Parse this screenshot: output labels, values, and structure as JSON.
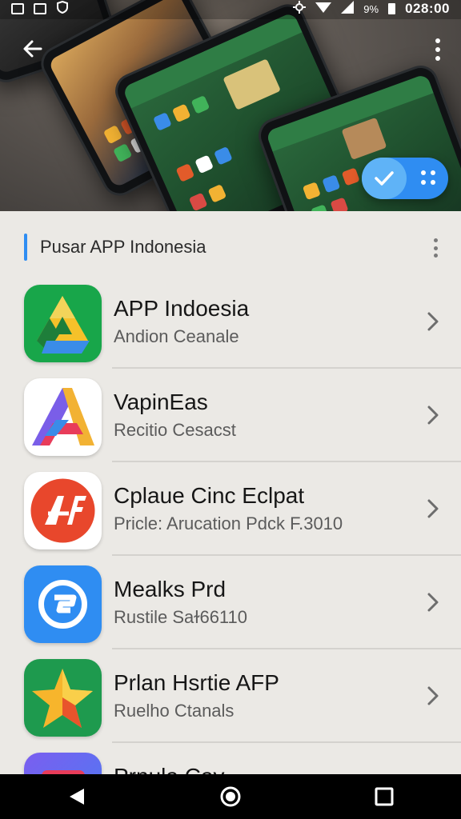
{
  "status_bar": {
    "battery": "9%",
    "time": "028:00"
  },
  "header": {
    "back_icon": "arrow-left-icon",
    "more_icon": "more-vertical-icon"
  },
  "fab": {
    "check_icon": "check-icon",
    "grid_icon": "grid-icon",
    "color_primary": "#2f8df2",
    "color_light": "#5fb3f7"
  },
  "section": {
    "title": "Pusar APP Indonesia",
    "accent_color": "#2f8df2"
  },
  "apps": [
    {
      "title": "APP Indoesia",
      "subtitle": "Andion Ceanale",
      "icon": "drive-like-icon"
    },
    {
      "title": "VapinEas",
      "subtitle": "Recitio Cesacst",
      "icon": "triangle-a-icon"
    },
    {
      "title": "Cplaue Cinc Eclpat",
      "subtitle": "Pricle: Arucation Pdck F.3010",
      "icon": "af-logo-icon"
    },
    {
      "title": "Mealks Prd",
      "subtitle": "Rustile Saɫ66110",
      "icon": "g-logo-icon"
    },
    {
      "title": "Prlan Hsrtie AFP",
      "subtitle": "Ruelho Ctanals",
      "icon": "star-icon"
    },
    {
      "title": "Prnula Cav",
      "subtitle": "",
      "icon": "app-icon"
    }
  ],
  "nav": {
    "back": "nav-back-icon",
    "home": "nav-home-icon",
    "recents": "nav-recents-icon"
  }
}
